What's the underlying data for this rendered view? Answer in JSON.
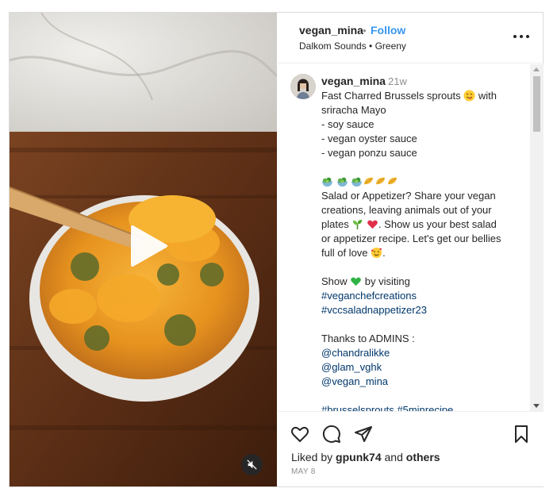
{
  "post": {
    "username": "vegan_mina",
    "follow_label": "Follow",
    "dot": "•",
    "audio": "Dalkom Sounds • Greeny",
    "time_ago": "21w",
    "caption_lines": [
      "Fast Charred Brussels sprouts",
      "with",
      "sriracha Mayo",
      "- soy sauce",
      "- vegan oyster sauce",
      "- vegan ponzu sauce",
      "Salad or Appetizer? Share your vegan",
      "creations, leaving animals out of your",
      "plates",
      ". Show us your best salad",
      "or appetizer recipe. Let's get our bellies",
      "full of love",
      ".",
      "Show",
      "by visiting"
    ],
    "hashtags": [
      "#veganchefcreations",
      "#vccsaladnappetizer23",
      "#brusselsprouts #5minrecipe"
    ],
    "thanks_label": "Thanks to ADMINS :",
    "mentions": [
      "@chandralikke",
      "@glam_vghk",
      "@vegan_mina"
    ],
    "liked_prefix": "Liked by",
    "liked_user": "gpunk74",
    "liked_and": "and",
    "liked_others": "others",
    "date": "MAY 8"
  },
  "icons": {
    "like": "heart-icon",
    "comment": "comment-icon",
    "share": "paper-plane-icon",
    "save": "bookmark-icon",
    "play": "play-icon",
    "mute": "muted-speaker-icon",
    "more": "more-options-icon"
  },
  "colors": {
    "accent": "#3897f0",
    "tag": "#00376b",
    "muted": "#8e8e8e"
  }
}
